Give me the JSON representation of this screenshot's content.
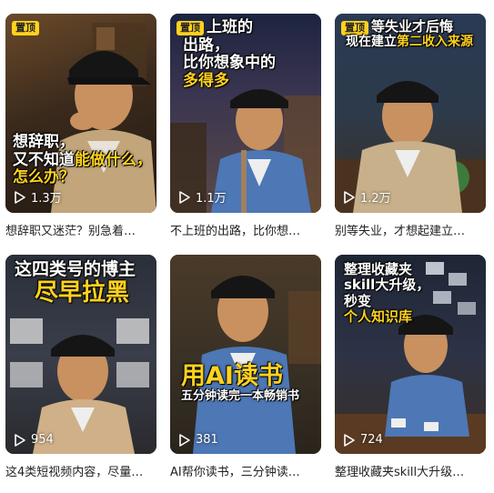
{
  "pin_label": "置顶",
  "cards": [
    {
      "title_lines": [
        "想辞职，",
        "又不知道能做什么，",
        "怎么办？"
      ],
      "highlight": "能做什么，",
      "views": "1.3万",
      "caption": "想辞职又迷茫？别急着…",
      "pinned": true
    },
    {
      "title_lines": [
        "上班的",
        "出路，",
        "比你想象中的",
        "多得多"
      ],
      "views": "1.1万",
      "caption": "不上班的出路，比你想…",
      "pinned": true
    },
    {
      "title_lines": [
        "等失业才后悔",
        "现在建立第二收入来源"
      ],
      "views": "1.2万",
      "caption": "别等失业，才想起建立…",
      "pinned": true
    },
    {
      "title_lines": [
        "这四类号的博主",
        "尽早拉黑"
      ],
      "views": "954",
      "caption": "这4类短视频内容，尽量…",
      "pinned": false
    },
    {
      "title_lines": [
        "用AI读书",
        "五分钟读完一本畅销书"
      ],
      "views": "381",
      "caption": "AI帮你读书，三分钟读…",
      "pinned": false
    },
    {
      "title_lines": [
        "整理收藏夹",
        "skill大升级，",
        "秒变",
        "个人知识库"
      ],
      "views": "724",
      "caption": "整理收藏夹skill大升级…",
      "pinned": false
    }
  ]
}
